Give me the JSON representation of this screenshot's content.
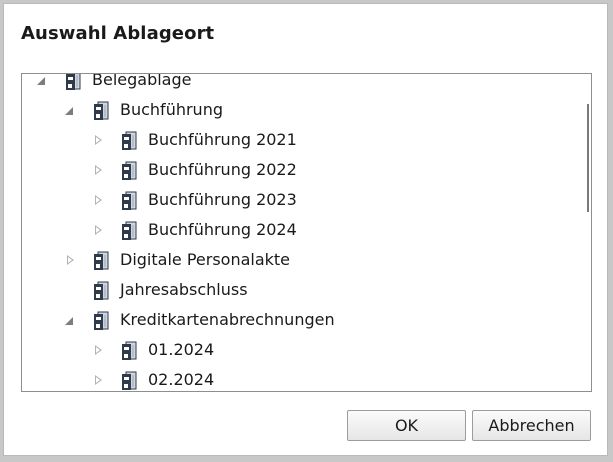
{
  "dialog": {
    "title": "Auswahl Ablageort",
    "ok_label": "OK",
    "cancel_label": "Abbrechen"
  },
  "tree": [
    {
      "label": "Belegablage",
      "level": 0,
      "expander": "expanded"
    },
    {
      "label": "Buchführung",
      "level": 1,
      "expander": "expanded"
    },
    {
      "label": "Buchführung 2021",
      "level": 2,
      "expander": "collapsed"
    },
    {
      "label": "Buchführung 2022",
      "level": 2,
      "expander": "collapsed"
    },
    {
      "label": "Buchführung 2023",
      "level": 2,
      "expander": "collapsed"
    },
    {
      "label": "Buchführung 2024",
      "level": 2,
      "expander": "collapsed"
    },
    {
      "label": "Digitale Personalakte",
      "level": 1,
      "expander": "collapsed"
    },
    {
      "label": "Jahresabschluss",
      "level": 1,
      "expander": "none"
    },
    {
      "label": "Kreditkartenabrechnungen",
      "level": 1,
      "expander": "expanded"
    },
    {
      "label": "01.2024",
      "level": 2,
      "expander": "collapsed"
    },
    {
      "label": "02.2024",
      "level": 2,
      "expander": "collapsed"
    }
  ],
  "colors": {
    "icon_dark": "#2f3a4a",
    "icon_light": "#cfd6e0"
  }
}
